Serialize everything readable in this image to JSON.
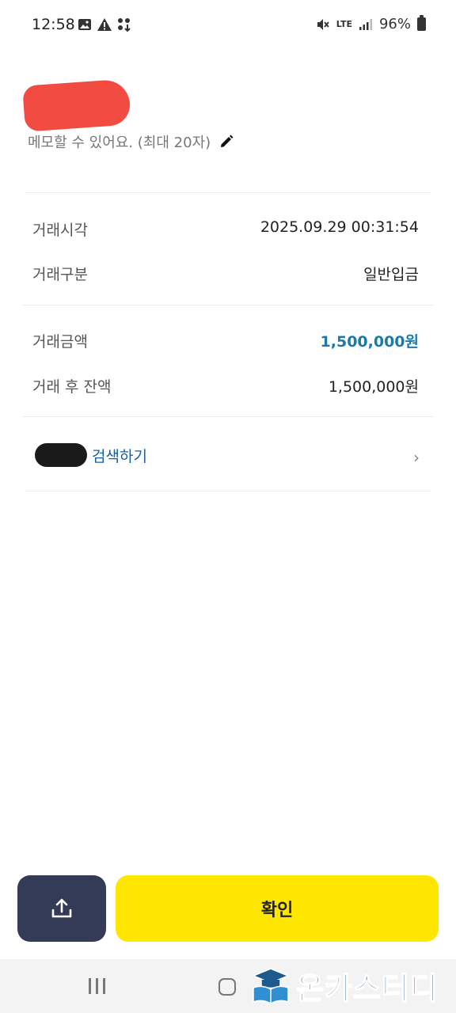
{
  "status_bar": {
    "time": "12:58",
    "network": "LTE",
    "battery": "96%"
  },
  "memo": {
    "placeholder": "메모할 수 있어요. (최대 20자)"
  },
  "details": {
    "time_label": "거래시각",
    "time_value": "2025.09.29 00:31:54",
    "type_label": "거래구분",
    "type_value": "일반입금",
    "amount_label": "거래금액",
    "amount_value": "1,500,000원",
    "balance_label": "거래 후 잔액",
    "balance_value": "1,500,000원"
  },
  "search": {
    "label": "검색하기"
  },
  "buttons": {
    "confirm_label": "확인"
  },
  "watermark": {
    "text": "온카스터디"
  },
  "colors": {
    "accent_amount": "#1b7aa8",
    "confirm_bg": "#ffe600",
    "share_bg": "#333b56",
    "link": "#1b5fa0"
  }
}
